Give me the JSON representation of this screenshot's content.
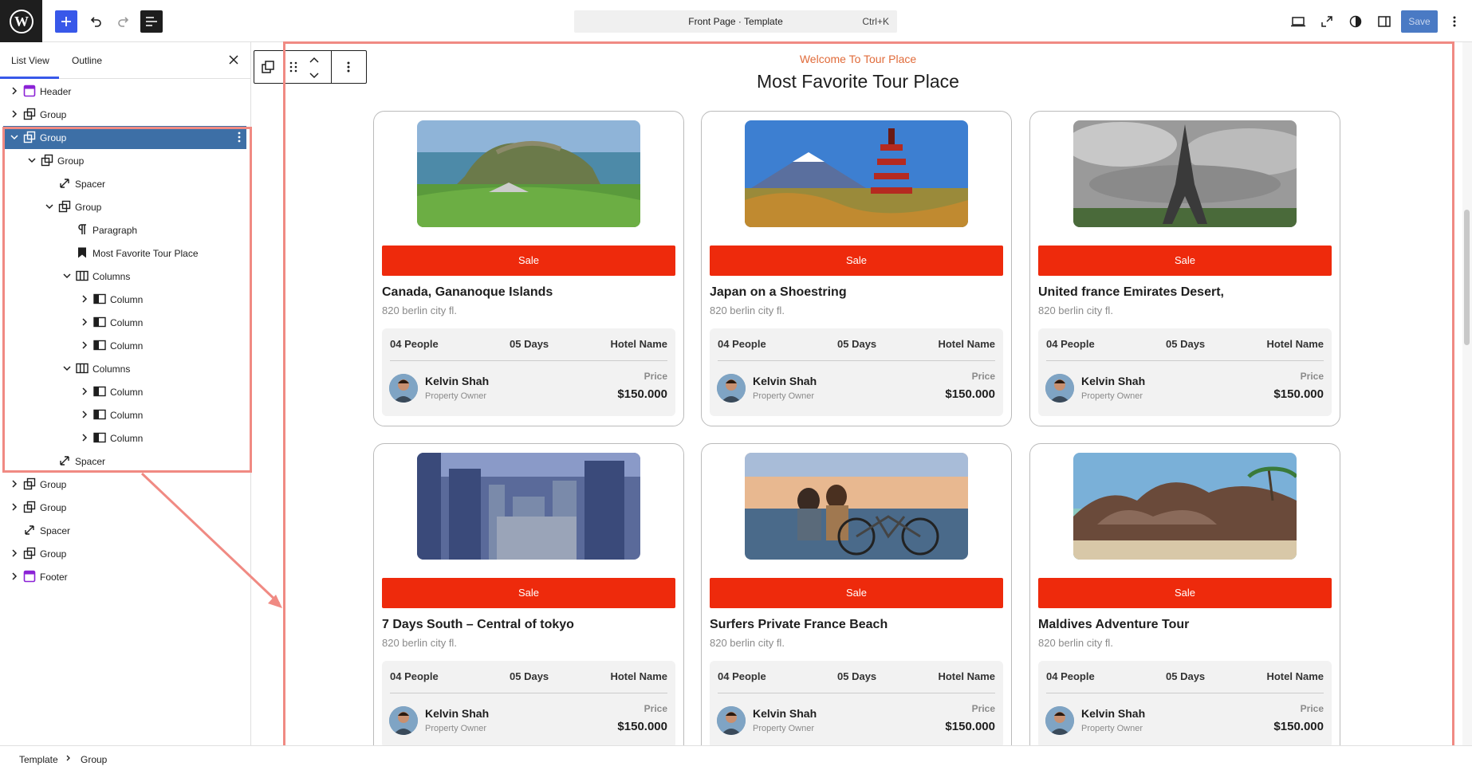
{
  "toolbar": {
    "command_title": "Front Page · Template",
    "command_shortcut": "Ctrl+K",
    "save_label": "Save"
  },
  "sidebar": {
    "tabs": [
      {
        "label": "List View"
      },
      {
        "label": "Outline"
      }
    ],
    "items": [
      {
        "label": "Header",
        "icon": "template-part-icon"
      },
      {
        "label": "Group",
        "icon": "group-icon"
      },
      {
        "label": "Group",
        "icon": "group-icon"
      },
      {
        "label": "Group",
        "icon": "group-icon"
      },
      {
        "label": "Spacer",
        "icon": "spacer-icon"
      },
      {
        "label": "Group",
        "icon": "group-icon"
      },
      {
        "label": "Paragraph",
        "icon": "paragraph-icon"
      },
      {
        "label": "Most Favorite Tour Place",
        "icon": "bookmark-icon"
      },
      {
        "label": "Columns",
        "icon": "columns-icon"
      },
      {
        "label": "Column",
        "icon": "column-icon"
      },
      {
        "label": "Column",
        "icon": "column-icon"
      },
      {
        "label": "Column",
        "icon": "column-icon"
      },
      {
        "label": "Columns",
        "icon": "columns-icon"
      },
      {
        "label": "Column",
        "icon": "column-icon"
      },
      {
        "label": "Column",
        "icon": "column-icon"
      },
      {
        "label": "Column",
        "icon": "column-icon"
      },
      {
        "label": "Spacer",
        "icon": "spacer-icon"
      },
      {
        "label": "Group",
        "icon": "group-icon"
      },
      {
        "label": "Group",
        "icon": "group-icon"
      },
      {
        "label": "Spacer",
        "icon": "spacer-icon"
      },
      {
        "label": "Group",
        "icon": "group-icon"
      },
      {
        "label": "Footer",
        "icon": "template-part-icon"
      }
    ]
  },
  "canvas": {
    "subtitle": "Welcome To Tour Place",
    "title": "Most Favorite Tour Place",
    "cards": [
      {
        "sale": "Sale",
        "name": "Canada, Gananoque Islands",
        "address": "820 berlin city fl.",
        "people": "04 People",
        "days": "05 Days",
        "hotel": "Hotel Name",
        "owner": "Kelvin Shah",
        "role": "Property Owner",
        "price_label": "Price",
        "price": "$150.000"
      },
      {
        "sale": "Sale",
        "name": "Japan on a Shoestring",
        "address": "820 berlin city fl.",
        "people": "04 People",
        "days": "05 Days",
        "hotel": "Hotel Name",
        "owner": "Kelvin Shah",
        "role": "Property Owner",
        "price_label": "Price",
        "price": "$150.000"
      },
      {
        "sale": "Sale",
        "name": "United france Emirates Desert,",
        "address": "820 berlin city fl.",
        "people": "04 People",
        "days": "05 Days",
        "hotel": "Hotel Name",
        "owner": "Kelvin Shah",
        "role": "Property Owner",
        "price_label": "Price",
        "price": "$150.000"
      },
      {
        "sale": "Sale",
        "name": "7 Days South – Central of tokyo",
        "address": "820 berlin city fl.",
        "people": "04 People",
        "days": "05 Days",
        "hotel": "Hotel Name",
        "owner": "Kelvin Shah",
        "role": "Property Owner",
        "price_label": "Price",
        "price": "$150.000"
      },
      {
        "sale": "Sale",
        "name": "Surfers Private France Beach",
        "address": "820 berlin city fl.",
        "people": "04 People",
        "days": "05 Days",
        "hotel": "Hotel Name",
        "owner": "Kelvin Shah",
        "role": "Property Owner",
        "price_label": "Price",
        "price": "$150.000"
      },
      {
        "sale": "Sale",
        "name": "Maldives Adventure Tour",
        "address": "820 berlin city fl.",
        "people": "04 People",
        "days": "05 Days",
        "hotel": "Hotel Name",
        "owner": "Kelvin Shah",
        "role": "Property Owner",
        "price_label": "Price",
        "price": "$150.000"
      }
    ]
  },
  "breadcrumb": [
    "Template",
    "Group"
  ],
  "colors": {
    "accent": "#3858e9",
    "selection": "#3d6fa6",
    "sale": "#ee2a0c",
    "annotation": "#f08a83",
    "subtitle": "#e06b3a"
  }
}
